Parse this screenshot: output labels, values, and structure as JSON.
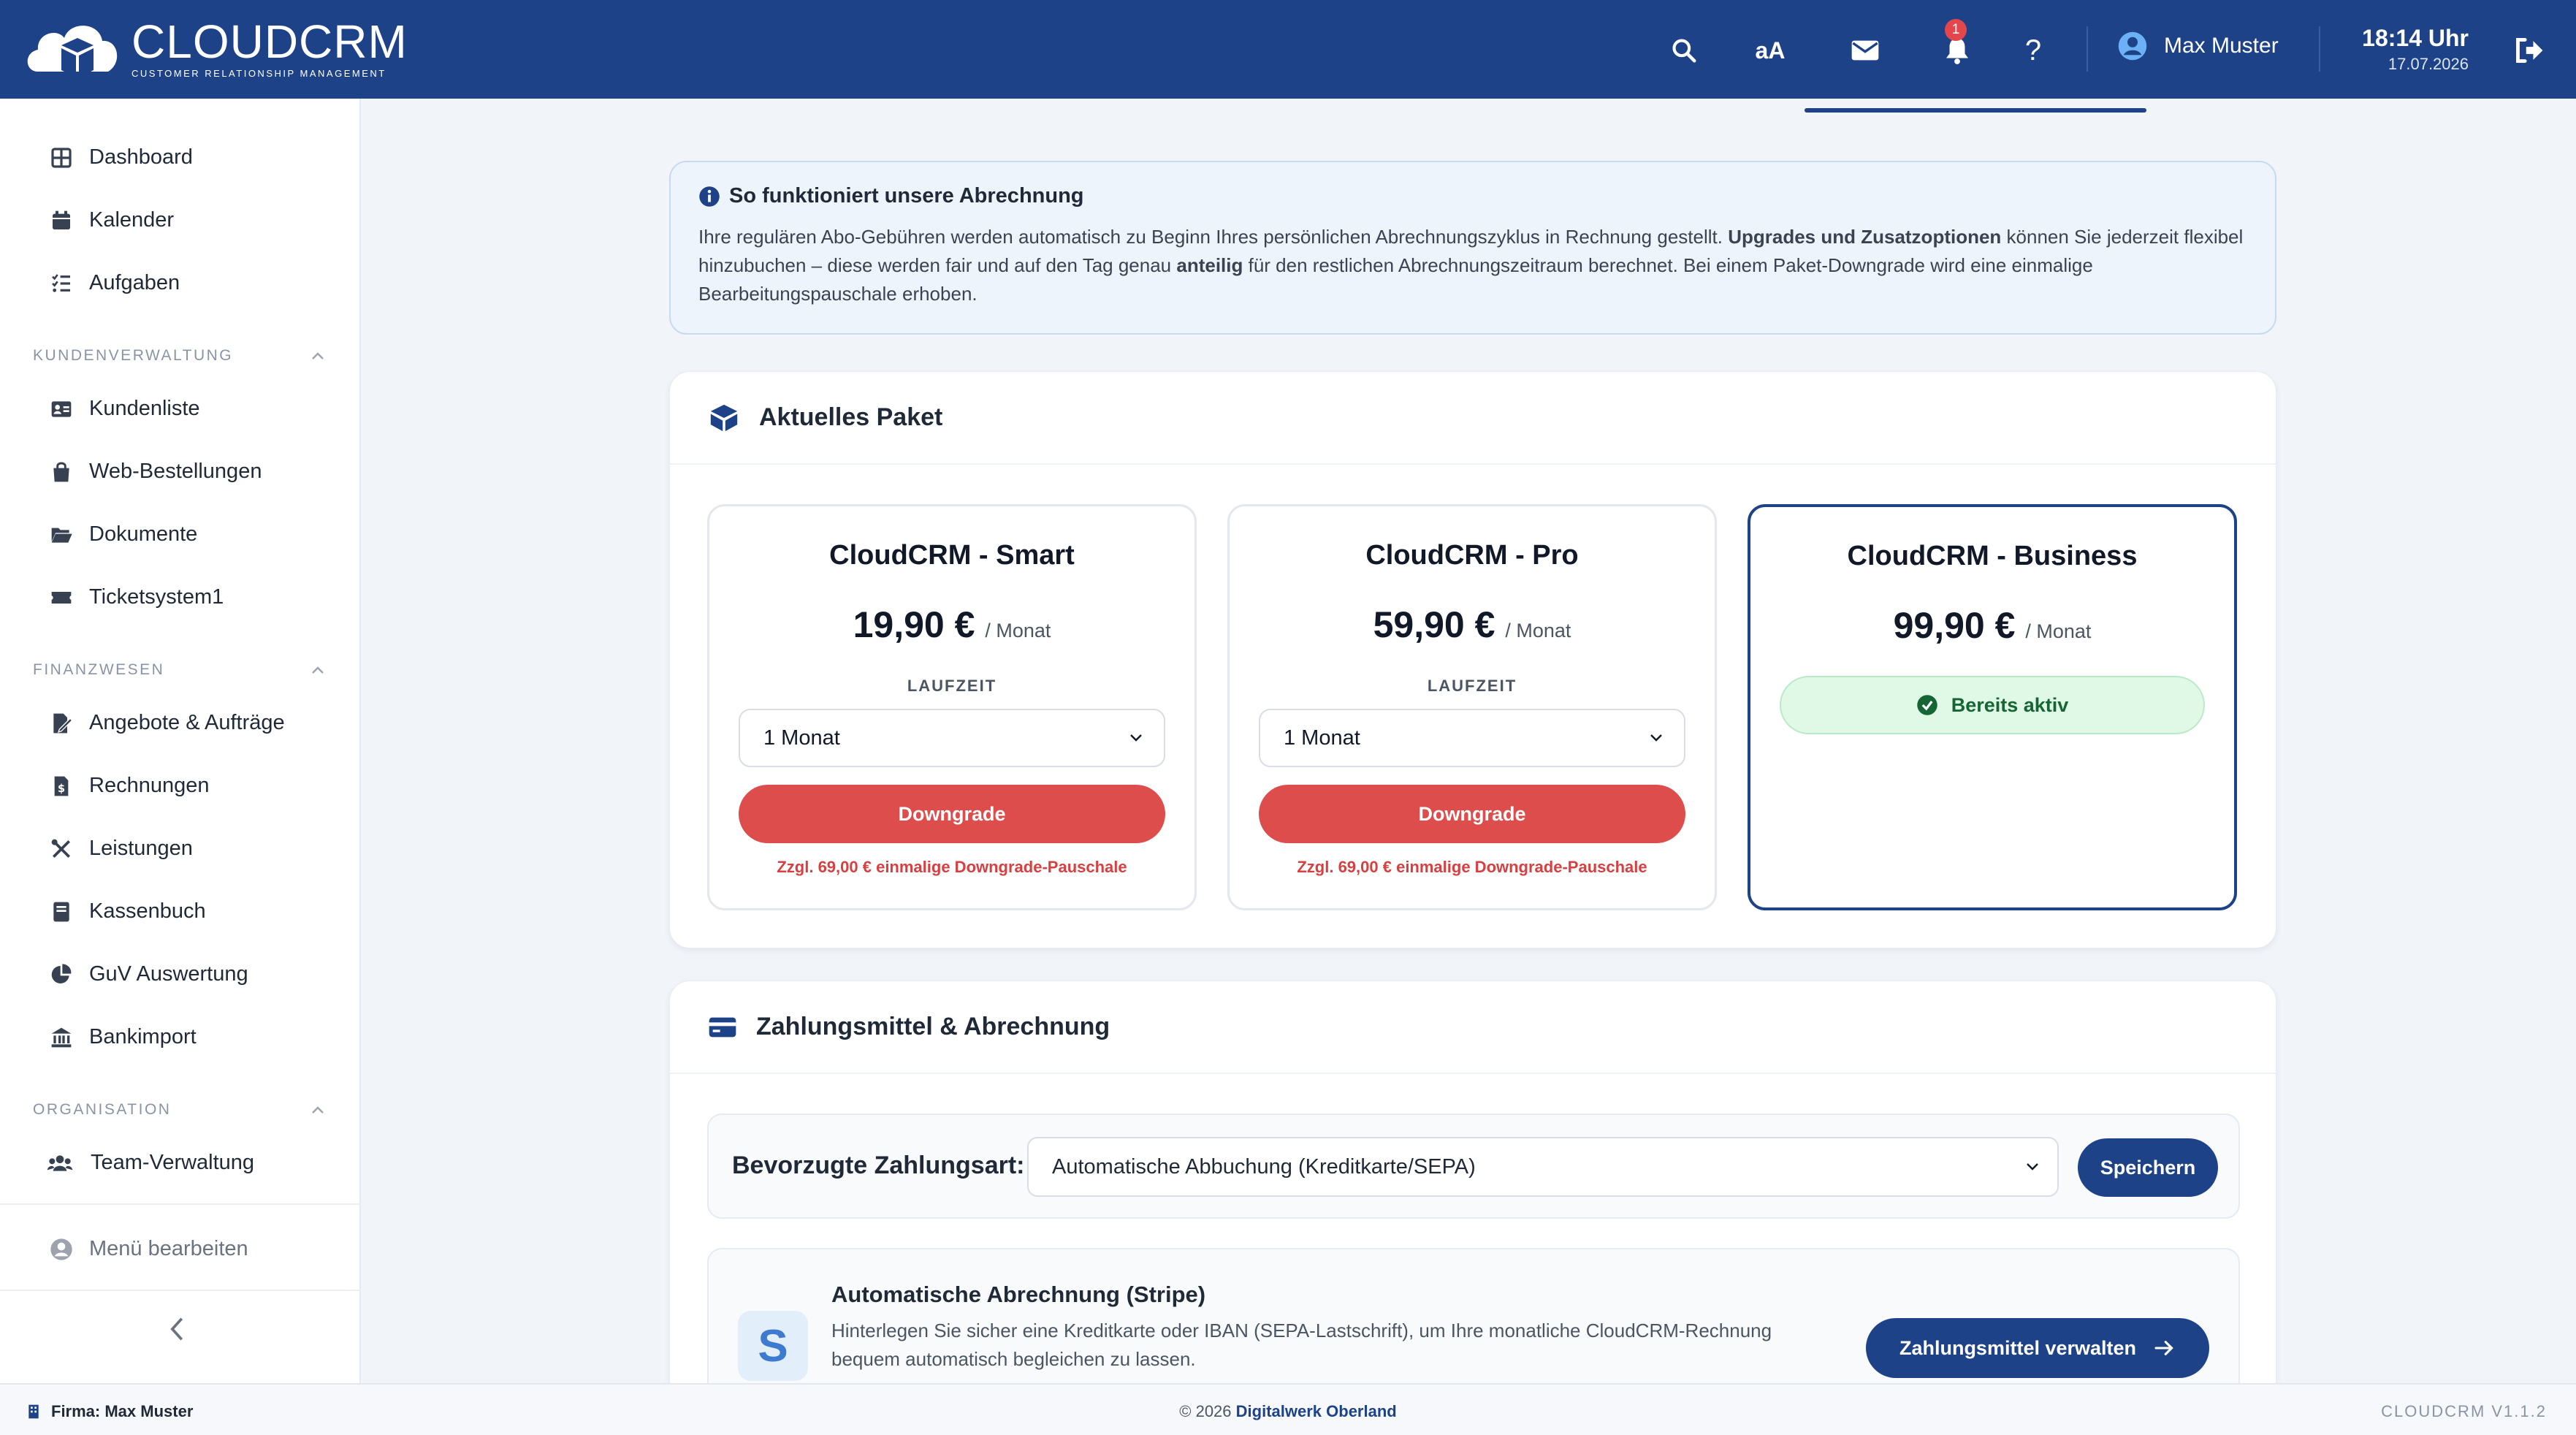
{
  "header": {
    "logo_name": "CLOUDCRM",
    "logo_tagline": "CUSTOMER RELATIONSHIP MANAGEMENT",
    "font_size_label": "aA",
    "notification_count": "1",
    "user_name": "Max Muster",
    "time": "18:14 Uhr",
    "date": "17.07.2026"
  },
  "sidebar": {
    "top_items": [
      {
        "label": "Dashboard",
        "icon": "dashboard-icon"
      },
      {
        "label": "Kalender",
        "icon": "calendar-icon"
      },
      {
        "label": "Aufgaben",
        "icon": "tasks-icon"
      }
    ],
    "sections": [
      {
        "title": "KUNDENVERWALTUNG",
        "items": [
          "Kundenliste",
          "Web-Bestellungen",
          "Dokumente",
          "Ticketsystem1"
        ]
      },
      {
        "title": "FINANZWESEN",
        "items": [
          "Angebote & Aufträge",
          "Rechnungen",
          "Leistungen",
          "Kassenbuch",
          "GuV Auswertung",
          "Bankimport"
        ]
      },
      {
        "title": "ORGANISATION",
        "items": [
          "Team-Verwaltung"
        ]
      }
    ],
    "edit_menu": "Menü bearbeiten"
  },
  "info": {
    "title": "So funktioniert unsere Abrechnung",
    "p1": "Ihre regulären Abo-Gebühren werden automatisch zu Beginn Ihres persönlichen Abrechnungszyklus in Rechnung gestellt. ",
    "b1": "Upgrades und Zusatzoptionen",
    "p2": " können Sie jederzeit flexibel hinzubuchen – diese werden fair und auf den Tag genau ",
    "b2": "anteilig",
    "p3": " für den restlichen Abrechnungszeitraum berechnet. Bei einem Paket-Downgrade wird eine einmalige Bearbeitungspauschale erhoben."
  },
  "package": {
    "title": "Aktuelles Paket",
    "plans": [
      {
        "name": "CloudCRM - Smart",
        "price": "19,90 €",
        "per": "/ Monat",
        "term_label": "LAUFZEIT",
        "term": "1 Monat",
        "button": "Downgrade",
        "note": "Zzgl. 69,00 € einmalige Downgrade-Pauschale"
      },
      {
        "name": "CloudCRM - Pro",
        "price": "59,90 €",
        "per": "/ Monat",
        "term_label": "LAUFZEIT",
        "term": "1 Monat",
        "button": "Downgrade",
        "note": "Zzgl. 69,00 € einmalige Downgrade-Pauschale"
      },
      {
        "name": "CloudCRM - Business",
        "price": "99,90 €",
        "per": "/ Monat",
        "status": "Bereits aktiv"
      }
    ]
  },
  "payment": {
    "title": "Zahlungsmittel & Abrechnung",
    "label": "Bevorzugte Zahlungsart:",
    "selected": "Automatische Abbuchung (Kreditkarte/SEPA)",
    "save": "Speichern",
    "stripe_letter": "S",
    "stripe_title": "Automatische Abrechnung (Stripe)",
    "stripe_text": "Hinterlegen Sie sicher eine Kreditkarte oder IBAN (SEPA-Lastschrift), um Ihre monatliche CloudCRM-Rechnung bequem automatisch begleichen zu lassen.",
    "manage": "Zahlungsmittel verwalten"
  },
  "footer": {
    "company": "Firma: Max Muster",
    "copyright_prefix": "© 2026 ",
    "copyright_brand": "Digitalwerk Oberland",
    "version": "CLOUDCRM V1.1.2"
  },
  "colors": {
    "primary": "#1e4288",
    "danger": "#dc4d4b",
    "success": "#166534",
    "badge": "#e4474b"
  }
}
